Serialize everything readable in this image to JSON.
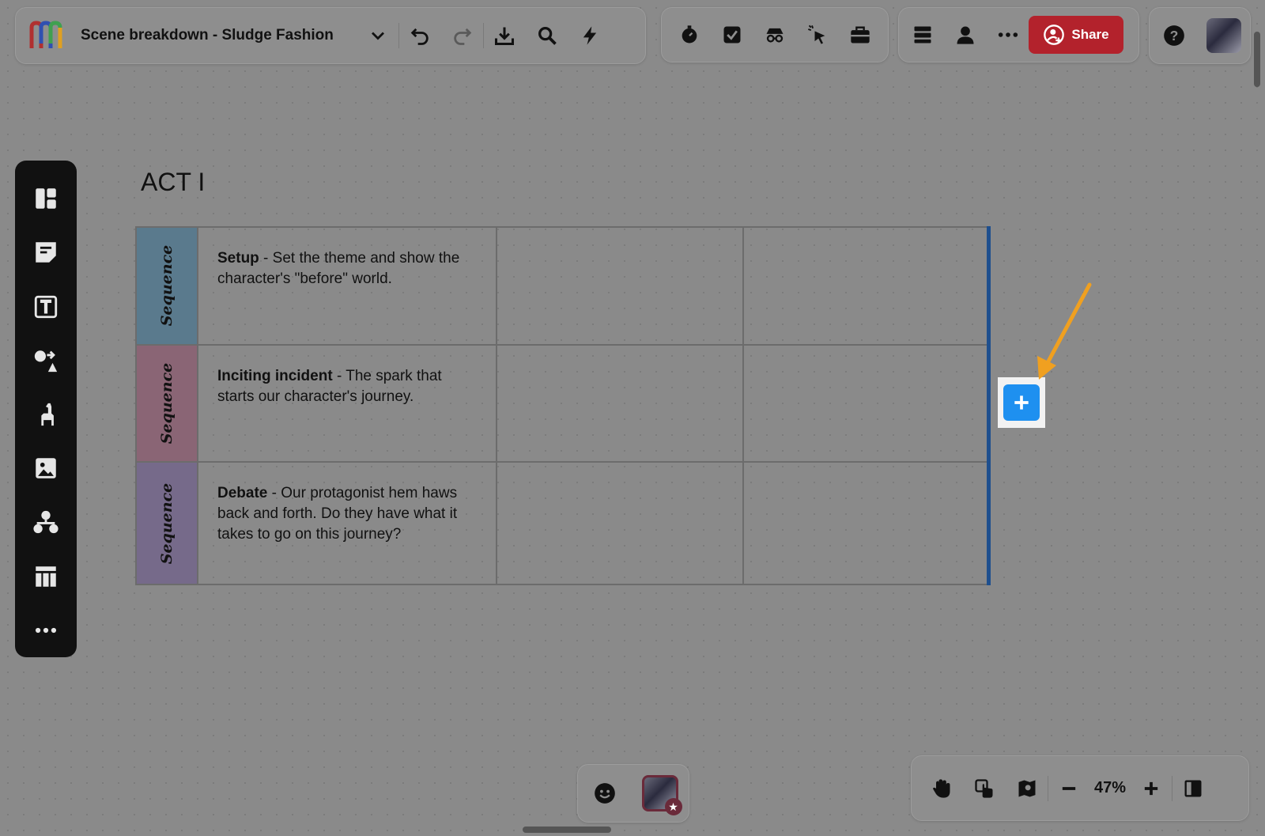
{
  "header": {
    "board_title": "Scene breakdown - Sludge Fashion",
    "share_label": "Share"
  },
  "canvas": {
    "act_title": "ACT I",
    "rows": [
      {
        "sequence_label": "Sequence",
        "color": "#5a7a8d",
        "title": "Setup",
        "text": " - Set the theme and show the character's \"before\" world."
      },
      {
        "sequence_label": "Sequence",
        "color": "#8a6575",
        "title": "Inciting incident",
        "text": " - The spark that starts our character's journey."
      },
      {
        "sequence_label": "Sequence",
        "color": "#766a8a",
        "title": "Debate",
        "text": " - Our protagonist hem haws back and forth. Do they have what it takes to go on this journey?"
      }
    ]
  },
  "zoom": {
    "level": "47%"
  },
  "colors": {
    "accent_share": "#b3222c",
    "add_button": "#1e90f0",
    "selection_edge": "#1e4f8e",
    "annotation_arrow": "#f0a020"
  },
  "icons": {
    "top_toolbar": [
      "logo",
      "chevron-down-icon",
      "undo-icon",
      "redo-icon",
      "download-icon",
      "search-icon",
      "lightning-icon",
      "timer-icon",
      "checkbox-icon",
      "incognito-icon",
      "cursor-click-icon",
      "briefcase-icon",
      "list-view-icon",
      "user-icon",
      "more-icon",
      "help-icon"
    ],
    "left_toolbar": [
      "templates-icon",
      "sticky-note-icon",
      "text-icon",
      "shapes-icon",
      "llama-icon",
      "image-icon",
      "diagram-icon",
      "table-icon",
      "more-icon"
    ],
    "bottom": [
      "emoji-icon",
      "hand-icon",
      "touch-icon",
      "map-icon",
      "zoom-out-icon",
      "zoom-in-icon",
      "sidebar-toggle-icon"
    ]
  }
}
